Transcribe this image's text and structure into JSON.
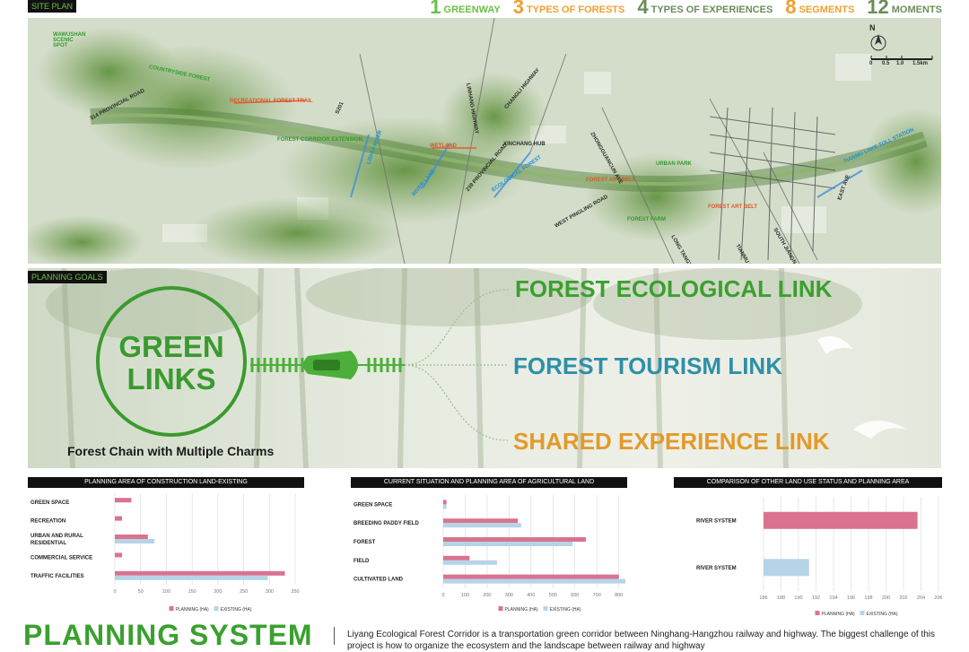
{
  "header": {
    "site_plan_tag": "SITE PLAN",
    "stats": [
      {
        "num": "1",
        "text": "GREENWAY",
        "color": "#6cc04a"
      },
      {
        "num": "3",
        "text": "TYPES OF FORESTS",
        "color": "#f0a030"
      },
      {
        "num": "4",
        "text": "TYPES OF EXPERIENCES",
        "color": "#6b8e5a"
      },
      {
        "num": "8",
        "text": "SEGMENTS",
        "color": "#f0a030"
      },
      {
        "num": "12",
        "text": "MOMENTS",
        "color": "#6b8e5a"
      }
    ]
  },
  "map": {
    "north": "N",
    "scale": [
      "0",
      "0.5",
      "1.0",
      "1.5km"
    ],
    "labels": {
      "wawushan": "WAWUSHAN SCENIC SPOT",
      "p314": "314 PROVINCIAL ROAD",
      "rec_forest": "RECREATIONAL FOREST TRAIL",
      "forest_ext": "FOREST CORRIDOR EXTENSION",
      "s201": "S201",
      "lishui": "LISHUI RIVER",
      "linhang": "LINHANG HIGHWAY",
      "changli": "CHANGLI HIGHWAY",
      "xinchang": "XINCHANG HUB",
      "p239": "239 PROVINCIAL ROAD",
      "forest_art": "FOREST ART BELT",
      "west_pingling": "WEST PINGLING ROAD",
      "zhongguancun": "ZHONGGUANCUN AVE",
      "long_tan": "LONG TANGTAN AVE",
      "tianmu_lake": "TIANMU LAKE AVE",
      "south_jiangnan": "SOUTH JIANGNAN",
      "east_ave": "EAST AVE",
      "tianmu_toll": "TIANMU LAKE TOLL STATION",
      "urban_park": "URBAN PARK",
      "forest_farm": "FOREST FARM",
      "countryside": "COUNTRYSIDE FOREST",
      "river_lane": "RIVER LANE",
      "eco_forest": "ECOLOGICAL FOREST",
      "wetland": "WETLAND"
    }
  },
  "goals": {
    "tag": "PLANNING GOALS",
    "green": "GREEN",
    "links": "LINKS",
    "subtitle": "Forest Chain with Multiple Charms",
    "link1": "FOREST ECOLOGICAL LINK",
    "link2": "FOREST TOURISM LINK",
    "link3": "SHARED EXPERIENCE LINK",
    "color1": "#3aa02f",
    "color2": "#2f8fa8",
    "color3": "#e39a2a"
  },
  "legend": {
    "planning": "PLANNING (HA)",
    "existing": "EXISTING (HA)"
  },
  "colors": {
    "planning": "#d9738f",
    "existing": "#b6d4e8"
  },
  "chart_data": [
    {
      "type": "bar",
      "title": "PLANNING AREA OF CONSTRUCTION LAND-EXISTING",
      "orientation": "horizontal",
      "categories": [
        "GREEN SPACE",
        "RECREATION",
        "URBAN AND RURAL RESIDENTIAL",
        "COMMERCIAL SERVICE",
        "TRAFFIC FACILITIES"
      ],
      "category_lines": [
        [
          "GREEN SPACE"
        ],
        [
          "RECREATION"
        ],
        [
          "URBAN AND RURAL",
          "RESIDENTIAL"
        ],
        [
          "COMMERCIAL SERVICE"
        ],
        [
          "TRAFFIC FACILITIES"
        ]
      ],
      "series": [
        {
          "name": "PLANNING (HA)",
          "values": [
            32,
            14,
            64,
            14,
            330
          ]
        },
        {
          "name": "EXISTING (HA)",
          "values": [
            0,
            0,
            77,
            0,
            297
          ]
        }
      ],
      "xticks": [
        0,
        50,
        100,
        150,
        200,
        250,
        300,
        350
      ],
      "xlim": [
        0,
        350
      ],
      "grid": true,
      "legend": "bottom"
    },
    {
      "type": "bar",
      "title": "CURRENT SITUATION AND PLANNING AREA OF AGRICULTURAL LAND",
      "orientation": "horizontal",
      "categories": [
        "GREEN SPACE",
        "BREEDING PADDY FIELD",
        "FOREST",
        "FIELD",
        "CULTIVATED LAND"
      ],
      "category_lines": [
        [
          "GREEN SPACE"
        ],
        [
          "BREEDING PADDY FIELD"
        ],
        [
          "FOREST"
        ],
        [
          "FIELD"
        ],
        [
          "CULTIVATED LAND"
        ]
      ],
      "series": [
        {
          "name": "PLANNING (HA)",
          "values": [
            15,
            340,
            650,
            120,
            800
          ]
        },
        {
          "name": "EXISTING (HA)",
          "values": [
            15,
            355,
            590,
            245,
            830
          ]
        }
      ],
      "xticks": [
        0,
        100,
        200,
        300,
        400,
        500,
        600,
        700,
        800
      ],
      "xlim": [
        0,
        830
      ],
      "grid": true,
      "legend": "bottom"
    },
    {
      "type": "bar",
      "title": "COMPARISON OF OTHER LAND USE STATUS AND PLANNING AREA",
      "orientation": "horizontal",
      "categories": [
        "RIVER SYSTEM",
        "RIVER SYSTEM"
      ],
      "category_lines": [
        [
          "RIVER SYSTEM"
        ],
        [
          "RIVER SYSTEM"
        ]
      ],
      "series": [
        {
          "name": "PLANNING (HA)",
          "values": [
            203.6,
            null
          ]
        },
        {
          "name": "EXISTING (HA)",
          "values": [
            null,
            191.2
          ]
        }
      ],
      "xticks": [
        186,
        188,
        190,
        192,
        194,
        196,
        198,
        200,
        202,
        204,
        206
      ],
      "xlim": [
        186,
        206
      ],
      "grid": true,
      "legend": "bottom"
    }
  ],
  "bottom": {
    "title": "PLANNING SYSTEM",
    "intro": "Liyang Ecological Forest Corridor is a transportation green corridor between Ninghang-Hangzhou railway and highway. The biggest challenge of this project is how to organize the ecosystem and the landscape between railway and highway"
  }
}
